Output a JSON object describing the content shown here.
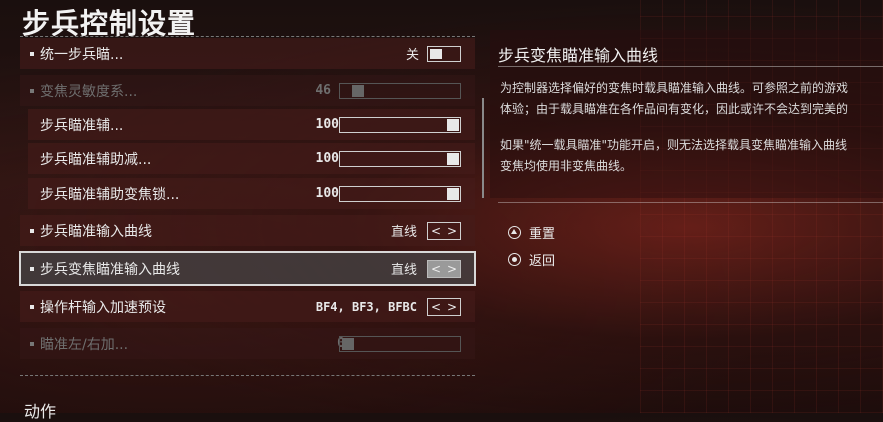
{
  "page": {
    "title": "步兵控制设置"
  },
  "settings": [
    {
      "label": "统一步兵瞄...",
      "value": "关",
      "type": "toggle",
      "state": "off"
    },
    {
      "label": "变焦灵敏度系...",
      "value": "46",
      "type": "slider",
      "level": 0.12,
      "disabled": true
    },
    {
      "label": "步兵瞄准辅...",
      "value": "100",
      "type": "slider",
      "level": 1.0
    },
    {
      "label": "步兵瞄准辅助减...",
      "value": "100",
      "type": "slider",
      "level": 1.0
    },
    {
      "label": "步兵瞄准辅助变焦锁...",
      "value": "100",
      "type": "slider",
      "level": 1.0
    },
    {
      "label": "步兵瞄准输入曲线",
      "value": "直线",
      "type": "selector"
    },
    {
      "label": "步兵变焦瞄准输入曲线",
      "value": "直线",
      "type": "selector",
      "selected": true
    },
    {
      "label": "操作杆输入加速预设",
      "value": "BF4, BF3, BFBC",
      "type": "selector"
    },
    {
      "label": "瞄准左/右加...",
      "value": "0",
      "type": "slider",
      "level": 0.0,
      "disabled": true
    }
  ],
  "arrows": {
    "left": "<",
    "right": ">"
  },
  "next_section": {
    "title": "动作"
  },
  "info": {
    "title": "步兵变焦瞄准输入曲线",
    "paragraph1_line1": "为控制器选择偏好的变焦时载具瞄准输入曲线。可参照之前的游戏",
    "paragraph1_line2": "体验；由于载具瞄准在各作品间有变化，因此或许不会达到完美的",
    "paragraph2_line1": "如果\"统一载具瞄准\"功能开启，则无法选择载具变焦瞄准输入曲线",
    "paragraph2_line2": "变焦均使用非变焦曲线。"
  },
  "actions": {
    "reset_label": "重置",
    "reset_icon": "triangle-button-icon",
    "back_label": "返回",
    "back_icon": "circle-button-icon"
  }
}
